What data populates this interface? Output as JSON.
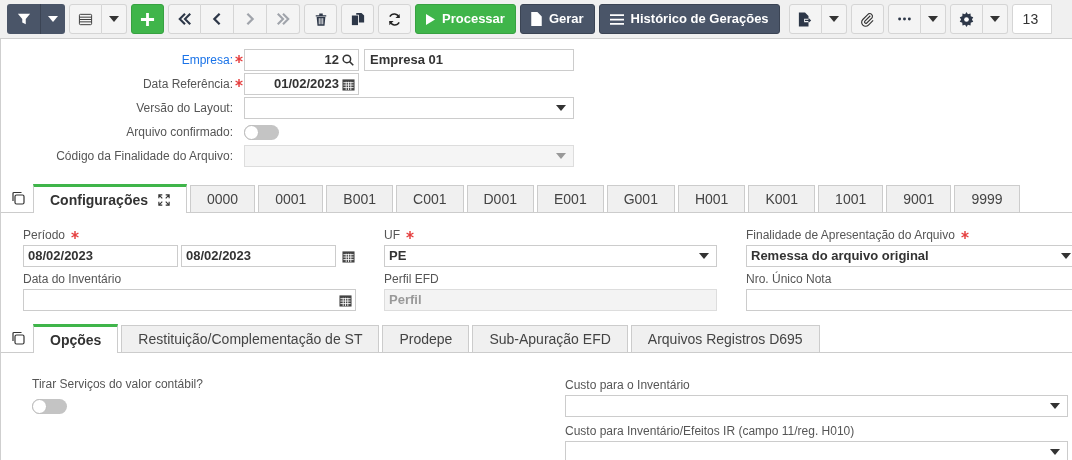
{
  "toolbar": {
    "nav": [
      {
        "disabled": false
      },
      {
        "disabled": false
      },
      {
        "disabled": true
      },
      {
        "disabled": true
      }
    ],
    "actions": [
      {
        "label": "Processar",
        "kind": "success"
      },
      {
        "label": "Gerar",
        "kind": "dark"
      },
      {
        "label": "Histórico de Gerações",
        "kind": "dark"
      }
    ],
    "page_field": "13"
  },
  "header_form": [
    {
      "label": "Empresa:",
      "kind": "lookup",
      "required": true,
      "link": true,
      "value": "12",
      "name_value": "Empresa 01"
    },
    {
      "label": "Data Referência:",
      "kind": "date",
      "required": true,
      "link": false,
      "value": "01/02/2023"
    },
    {
      "label": "Versão do Layout:",
      "kind": "select",
      "required": false,
      "link": false,
      "disabled": false
    },
    {
      "label": "Arquivo confirmado:",
      "kind": "toggle",
      "required": false,
      "link": false,
      "on": false
    },
    {
      "label": "Código da Finalidade do Arquivo:",
      "kind": "select",
      "required": false,
      "link": false,
      "disabled": true
    }
  ],
  "tabs": [
    {
      "label": "Configurações",
      "selected": true
    },
    {
      "label": "0000",
      "selected": false
    },
    {
      "label": "0001",
      "selected": false
    },
    {
      "label": "B001",
      "selected": false
    },
    {
      "label": "C001",
      "selected": false
    },
    {
      "label": "D001",
      "selected": false
    },
    {
      "label": "E001",
      "selected": false
    },
    {
      "label": "G001",
      "selected": false
    },
    {
      "label": "H001",
      "selected": false
    },
    {
      "label": "K001",
      "selected": false
    },
    {
      "label": "1001",
      "selected": false
    },
    {
      "label": "9001",
      "selected": false
    },
    {
      "label": "9999",
      "selected": false
    }
  ],
  "config_fields": [
    {
      "label": "Período",
      "required": true,
      "kind": "daterange",
      "values": [
        "08/02/2023",
        "08/02/2023"
      ]
    },
    {
      "label": "UF",
      "required": true,
      "kind": "select",
      "value": "PE"
    },
    {
      "label": "Finalidade de Apresentação do Arquivo",
      "required": true,
      "kind": "select",
      "value": "Remessa do arquivo original"
    },
    {
      "label": "Data do Inventário",
      "required": false,
      "kind": "date"
    },
    {
      "label": "Perfil EFD",
      "required": false,
      "kind": "readonly",
      "placeholder": "Perfil"
    },
    {
      "label": "Nro. Único Nota",
      "required": false,
      "kind": "text"
    }
  ],
  "subtabs": [
    {
      "label": "Opções",
      "selected": true
    },
    {
      "label": "Restituição/Complementação de ST",
      "selected": false
    },
    {
      "label": "Prodepe",
      "selected": false
    },
    {
      "label": "Sub-Apuração EFD",
      "selected": false
    },
    {
      "label": "Arquivos Registros D695",
      "selected": false
    }
  ],
  "options": {
    "left": [
      {
        "label": "Tirar Serviços do valor contábil?",
        "kind": "toggle",
        "on": false
      }
    ],
    "right": [
      {
        "label": "Custo para o Inventário",
        "kind": "select"
      },
      {
        "label": "Custo para Inventário/Efeitos IR (campo 11/reg. H010)",
        "kind": "select"
      }
    ]
  }
}
